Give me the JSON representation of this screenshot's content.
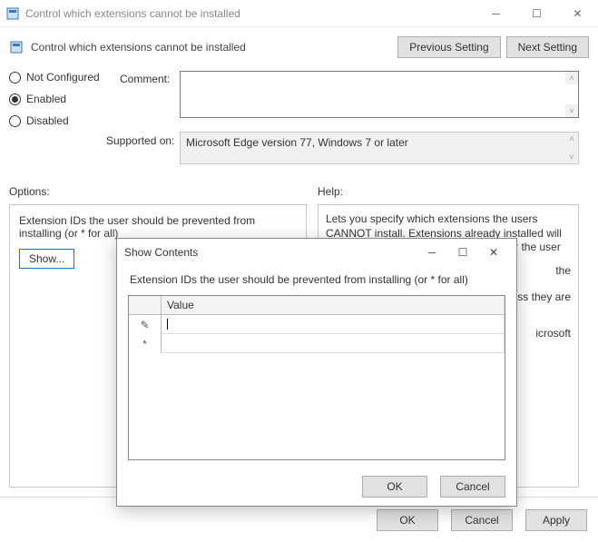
{
  "window": {
    "title": "Control which extensions cannot be installed"
  },
  "header": {
    "title": "Control which extensions cannot be installed",
    "prev_btn": "Previous Setting",
    "next_btn": "Next Setting"
  },
  "radios": {
    "not_configured": "Not Configured",
    "enabled": "Enabled",
    "disabled": "Disabled",
    "selected": "enabled"
  },
  "comment": {
    "label": "Comment:",
    "value": ""
  },
  "supported": {
    "label": "Supported on:",
    "value": "Microsoft Edge version 77, Windows 7 or later"
  },
  "sections": {
    "options": "Options:",
    "help": "Help:"
  },
  "options": {
    "field_label": "Extension IDs the user should be prevented from installing (or * for all)",
    "show_btn": "Show..."
  },
  "help": {
    "p1_a": "Lets you specify which extensions the users CANNOT install. Extensions already installed will be disabled if blocked, without a way for the user",
    "p1_tail": "the",
    "p2_tail": "ess they are",
    "p3_tail": "icrosoft"
  },
  "footer": {
    "ok": "OK",
    "cancel": "Cancel",
    "apply": "Apply"
  },
  "dialog": {
    "title": "Show Contents",
    "prompt": "Extension IDs the user should be prevented from installing (or * for all)",
    "col_value": "Value",
    "rows": [
      {
        "marker": "✎",
        "value": ""
      },
      {
        "marker": "*",
        "value": ""
      }
    ],
    "ok": "OK",
    "cancel": "Cancel"
  }
}
